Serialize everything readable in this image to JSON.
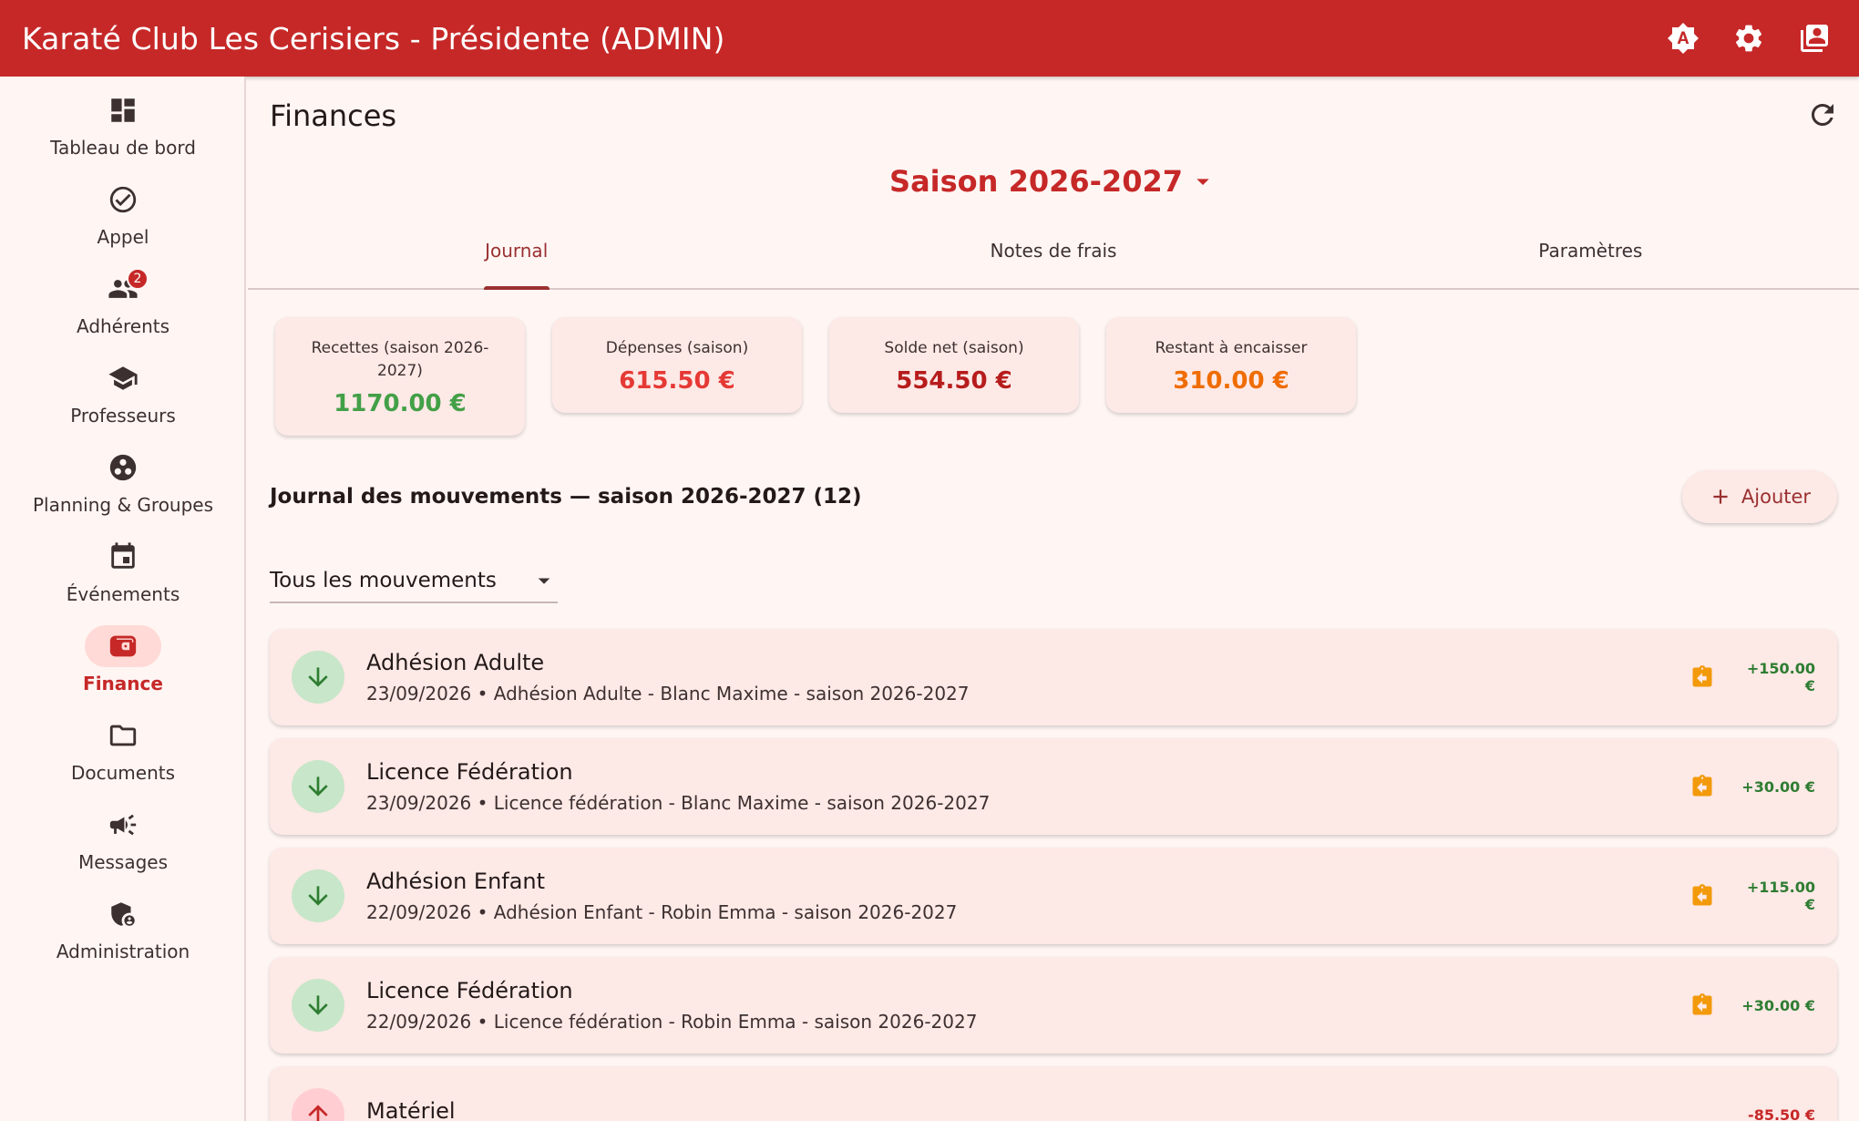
{
  "appbar": {
    "title": "Karaté Club Les Cerisiers - Présidente (ADMIN)",
    "icons": [
      "brightness-auto-icon",
      "settings-icon",
      "contacts-icon"
    ]
  },
  "rail": {
    "items": [
      {
        "label": "Tableau de bord",
        "icon": "dashboard-icon"
      },
      {
        "label": "Appel",
        "icon": "check-circle-icon"
      },
      {
        "label": "Adhérents",
        "icon": "people-icon",
        "badge": "2"
      },
      {
        "label": "Professeurs",
        "icon": "school-icon"
      },
      {
        "label": "Planning & Groupes",
        "icon": "workspaces-icon"
      },
      {
        "label": "Événements",
        "icon": "event-icon"
      },
      {
        "label": "Finance",
        "icon": "wallet-icon",
        "active": true
      },
      {
        "label": "Documents",
        "icon": "folder-icon"
      },
      {
        "label": "Messages",
        "icon": "campaign-icon"
      },
      {
        "label": "Administration",
        "icon": "admin-shield-icon"
      }
    ]
  },
  "page": {
    "title": "Finances",
    "season": "Saison 2026-2027"
  },
  "tabs": [
    {
      "label": "Journal",
      "active": true
    },
    {
      "label": "Notes de frais"
    },
    {
      "label": "Paramètres"
    }
  ],
  "cards": [
    {
      "label": "Recettes (saison 2026-2027)",
      "value": "1170.00 €",
      "color": "#43a047"
    },
    {
      "label": "Dépenses (saison)",
      "value": "615.50 €",
      "color": "#e53935"
    },
    {
      "label": "Solde net (saison)",
      "value": "554.50 €",
      "color": "#b71c1c"
    },
    {
      "label": "Restant à encaisser",
      "value": "310.00 €",
      "color": "#ef6c00"
    }
  ],
  "journal": {
    "title": "Journal des mouvements — saison 2026-2027 (12)",
    "add_label": "Ajouter",
    "filter": "Tous les mouvements",
    "rows": [
      {
        "title": "Adhésion Adulte",
        "sub": "23/09/2026 • Adhésion Adulte - Blanc Maxime - saison 2026-2027",
        "amount": "+150.00 €",
        "dir": "in"
      },
      {
        "title": "Licence Fédération",
        "sub": "23/09/2026 • Licence fédération - Blanc Maxime - saison 2026-2027",
        "amount": "+30.00 €",
        "dir": "in"
      },
      {
        "title": "Adhésion Enfant",
        "sub": "22/09/2026 • Adhésion Enfant - Robin Emma - saison 2026-2027",
        "amount": "+115.00 €",
        "dir": "in"
      },
      {
        "title": "Licence Fédération",
        "sub": "22/09/2026 • Licence fédération - Robin Emma - saison 2026-2027",
        "amount": "+30.00 €",
        "dir": "in"
      },
      {
        "title": "Matériel",
        "sub": "",
        "amount": "-85.50 €",
        "dir": "out"
      }
    ]
  },
  "colors": {
    "primary": "#c62828",
    "income": "#2e7d32",
    "expense": "#c62828",
    "pending": "#f29a0a"
  }
}
